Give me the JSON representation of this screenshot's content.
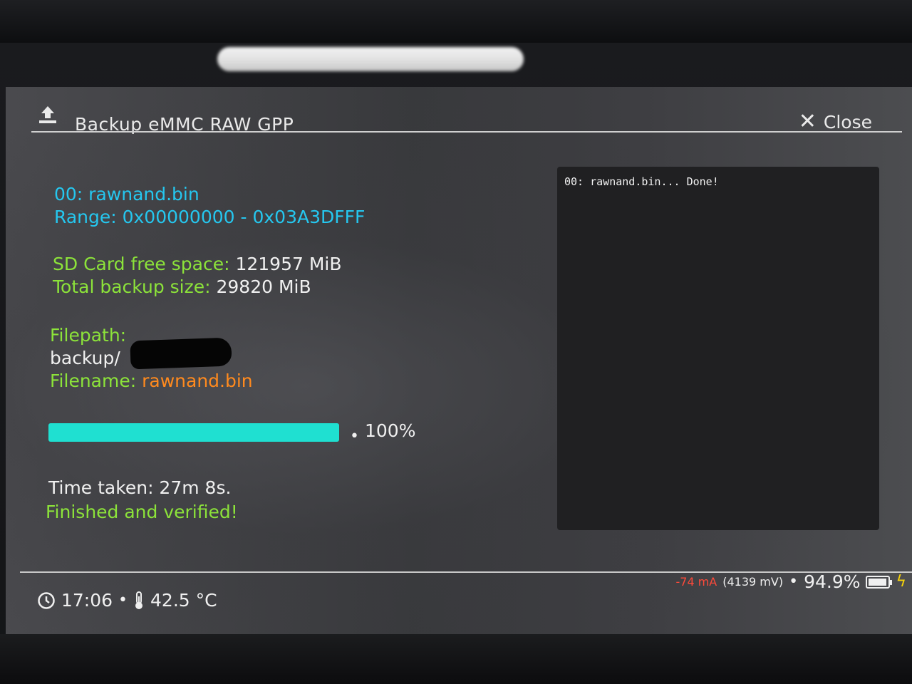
{
  "header": {
    "title": "Backup eMMC RAW GPP",
    "close_label": "Close",
    "upload_icon": "upload-icon",
    "close_icon": "close-icon"
  },
  "backup": {
    "part_line": "00: rawnand.bin",
    "range_line": "Range: 0x00000000 - 0x03A3DFFF",
    "sd_free_label": "SD Card free space:",
    "sd_free_value": "121957 MiB",
    "total_size_label": "Total backup size:",
    "total_size_value": "29820 MiB",
    "filepath_label": "Filepath:",
    "filepath_value": "backup/",
    "filename_label": "Filename:",
    "filename_value": "rawnand.bin",
    "progress_percent": 100,
    "progress_label": "100%",
    "time_taken": "Time taken: 27m 8s.",
    "status": "Finished and verified!"
  },
  "log": {
    "lines": [
      "00: rawnand.bin... Done!"
    ]
  },
  "footer": {
    "time": "17:06",
    "temperature": "42.5 °C",
    "current": "-74 mA",
    "voltage": "(4139 mV)",
    "battery_percent": "94.9%",
    "battery_level": 0.949,
    "charging_icon": "lightning-bolt-icon",
    "clock_icon": "clock-icon",
    "thermometer_icon": "thermometer-icon"
  },
  "colors": {
    "cyan": "#25c7ef",
    "green": "#8ce33a",
    "orange": "#ff8a1e",
    "progress": "#1fe0d1",
    "current_red": "#ff4a3a"
  }
}
